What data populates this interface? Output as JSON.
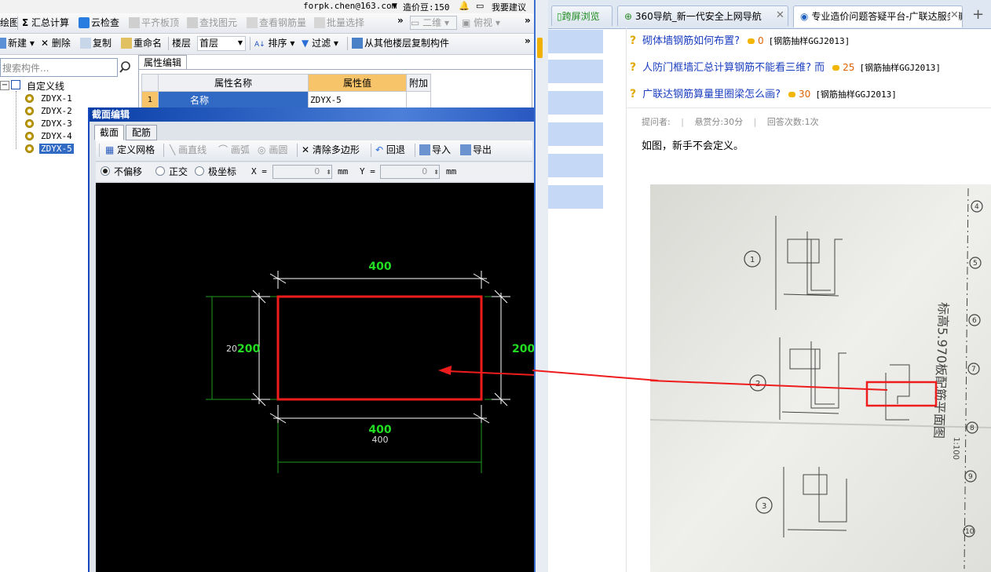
{
  "topbar": {
    "account": "forpk.chen@163.com",
    "beans_label": "造价豆:150",
    "suggest_label": "我要建议"
  },
  "toolbar1": {
    "draw_label": "绘图",
    "summary_label": "汇总计算",
    "cloud_check_label": "云检查",
    "flush_label": "平齐板顶",
    "find_label": "查找图元",
    "view_rebar_label": "查看钢筋量",
    "batch_select_label": "批量选择",
    "view_mode_value": "二维",
    "view_dir_value": "俯视"
  },
  "toolbar2": {
    "new_label": "新建",
    "delete_label": "删除",
    "copy_label": "复制",
    "rename_label": "重命名",
    "floor_label": "楼层",
    "floor_value": "首层",
    "sort_label": "排序",
    "filter_label": "过滤",
    "copy_from_floor_label": "从其他楼层复制构件"
  },
  "tree": {
    "search_placeholder": "搜索构件...",
    "root_label": "自定义线",
    "items": [
      "ZDYX-1",
      "ZDYX-2",
      "ZDYX-3",
      "ZDYX-4",
      "ZDYX-5"
    ],
    "selected_index": 4
  },
  "property_panel": {
    "tab_label": "属性编辑",
    "col_name": "属性名称",
    "col_value": "属性值",
    "col_extra": "附加",
    "rows": [
      {
        "index": "1",
        "name": "名称",
        "value": "ZDYX-5"
      }
    ]
  },
  "section_dialog": {
    "title": "截面编辑",
    "tabs": [
      "截面",
      "配筋"
    ],
    "active_tab": 0,
    "toolbar": {
      "define_grid": "定义网格",
      "draw_line": "画直线",
      "draw_arc": "画弧",
      "draw_circle": "画圆",
      "clear_polygon": "清除多边形",
      "undo": "回退",
      "import": "导入",
      "export": "导出"
    },
    "options": {
      "no_offset": "不偏移",
      "orthogonal": "正交",
      "polar": "极坐标",
      "x_label": "X =",
      "x_value": "0",
      "y_label": "Y =",
      "y_value": "0",
      "unit": "mm"
    },
    "drawing": {
      "top_dim": "400",
      "bottom_dim": "400",
      "bottom_dim_2": "400",
      "left_dim": "200",
      "left_dim_overlap": "20",
      "right_dim": "200"
    }
  },
  "browser": {
    "tabs": [
      {
        "label": "跨屏浏览"
      },
      {
        "label": "360导航_新一代安全上网导航"
      },
      {
        "label": "专业造价问题答疑平台-广联达服务新干线"
      }
    ],
    "active_tab": 2,
    "new_tab_symbol": "+",
    "questions": [
      {
        "title": "砌体墙钢筋如何布置?",
        "score": "0",
        "tag": "[钢筋抽样GGJ2013]"
      },
      {
        "title": "人防门框墙汇总计算钢筋不能看三维? 而",
        "score": "25",
        "tag": "[钢筋抽样GGJ2013]"
      },
      {
        "title": "广联达钢筋算量里圈梁怎么画?",
        "score": "30",
        "tag": "[钢筋抽样GGJ2013]"
      }
    ],
    "meta": {
      "asker": "提问者:",
      "reward": "悬赏分:30分",
      "answers": "回答次数:1次"
    },
    "question_body": "如图，新手不会定义。",
    "photo": {
      "vertical_text": "标高5.970板配筋平面图",
      "scale": "1:100",
      "circle_labels": [
        "1",
        "2",
        "3"
      ],
      "axis_labels": [
        "4",
        "5",
        "6",
        "7",
        "8",
        "9",
        "10"
      ]
    }
  },
  "colors": {
    "dim_green": "#22dd22",
    "highlight_red": "#ee1c1c",
    "link_blue": "#1a3ec0",
    "dialog_title_blue": "#0a3fa8"
  }
}
